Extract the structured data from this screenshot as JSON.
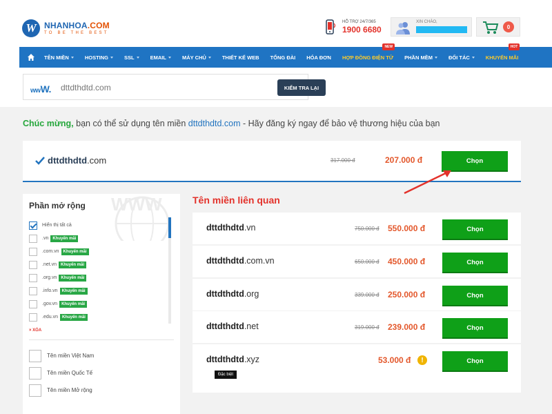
{
  "header": {
    "logo_letter": "W",
    "logo_name_main": "NHANHOA",
    "logo_name_dot": ".COM",
    "logo_tagline": "TO BE THE BEST",
    "hotline_label": "HỖ TRỢ 24/7/365",
    "hotline_number": "1900 6680",
    "user_greeting": "XIN CHÀO,",
    "cart_count": "0"
  },
  "nav": {
    "items": [
      {
        "label": "TÊN MIỀN",
        "caret": true
      },
      {
        "label": "HOSTING",
        "caret": true
      },
      {
        "label": "SSL",
        "caret": true
      },
      {
        "label": "EMAIL",
        "caret": true
      },
      {
        "label": "MÁY CHỦ",
        "caret": true
      },
      {
        "label": "THIẾT KẾ WEB",
        "caret": false
      },
      {
        "label": "TỔNG ĐÀI",
        "caret": false
      },
      {
        "label": "HÓA ĐƠN",
        "caret": false
      },
      {
        "label": "HỢP ĐỒNG ĐIỆN TỬ",
        "caret": false,
        "highlight": true,
        "badge": "NEW"
      },
      {
        "label": "PHẦN MỀM",
        "caret": true
      },
      {
        "label": "ĐỐI TÁC",
        "caret": true
      },
      {
        "label": "KHUYẾN MÃI",
        "caret": false,
        "highlight": true,
        "badge": "HOT"
      }
    ]
  },
  "search": {
    "prefix_small": "ww",
    "prefix_big": "W.",
    "value": "dttdthdtd.com",
    "button_label": "KIỂM TRA LẠI"
  },
  "congrats": {
    "highlight": "Chúc mừng,",
    "text_before": " bạn có thể sử dụng tên miền ",
    "domain": "dttdthdtd.com",
    "text_after": " - Hãy đăng ký ngay để bảo vệ thương hiệu của bạn"
  },
  "main_result": {
    "name": "dttdthdtd",
    "ext": ".com",
    "old_price": "317.000 đ",
    "new_price": "207.000 đ",
    "button_label": "Chọn"
  },
  "sidebar": {
    "title": "Phần mở rộng",
    "show_all_label": "Hiển thị tất cả",
    "extensions": [
      {
        "label": ".vn",
        "promo": "Khuyến mãi"
      },
      {
        "label": ".com.vn",
        "promo": "Khuyến mãi"
      },
      {
        "label": ".net.vn",
        "promo": "Khuyến mãi"
      },
      {
        "label": ".org.vn",
        "promo": "Khuyến mãi"
      },
      {
        "label": ".info.vn",
        "promo": "Khuyến mãi"
      },
      {
        "label": ".gov.vn",
        "promo": "Khuyến mãi"
      },
      {
        "label": ".edu.vn",
        "promo": "Khuyến mãi"
      }
    ],
    "clear_label": "× XÓA",
    "categories": [
      "Tên miền Việt Nam",
      "Tên miền Quốc Tế",
      "Tên miền Mở rộng"
    ]
  },
  "related": {
    "title": "Tên miền liên quan",
    "items": [
      {
        "name": "dttdthdtd",
        "ext": ".vn",
        "old_price": "750.000 đ",
        "new_price": "550.000 đ",
        "button": "Chọn"
      },
      {
        "name": "dttdthdtd",
        "ext": ".com.vn",
        "old_price": "650.000 đ",
        "new_price": "450.000 đ",
        "button": "Chọn"
      },
      {
        "name": "dttdthdtd",
        "ext": ".org",
        "old_price": "339.000 đ",
        "new_price": "250.000 đ",
        "button": "Chọn"
      },
      {
        "name": "dttdthdtd",
        "ext": ".net",
        "old_price": "319.000 đ",
        "new_price": "239.000 đ",
        "button": "Chọn"
      },
      {
        "name": "dttdthdtd",
        "ext": ".xyz",
        "old_price": "",
        "new_price": "53.000 đ",
        "button": "Chọn",
        "warning": "!",
        "tag": "Đặc biệt"
      }
    ]
  },
  "colors": {
    "brand_blue": "#1f74c3",
    "accent_orange": "#e3572b",
    "button_green": "#0fa018",
    "promo_green": "#28a745",
    "hot_red": "#e3322b",
    "nav_highlight": "#ffcc29"
  }
}
